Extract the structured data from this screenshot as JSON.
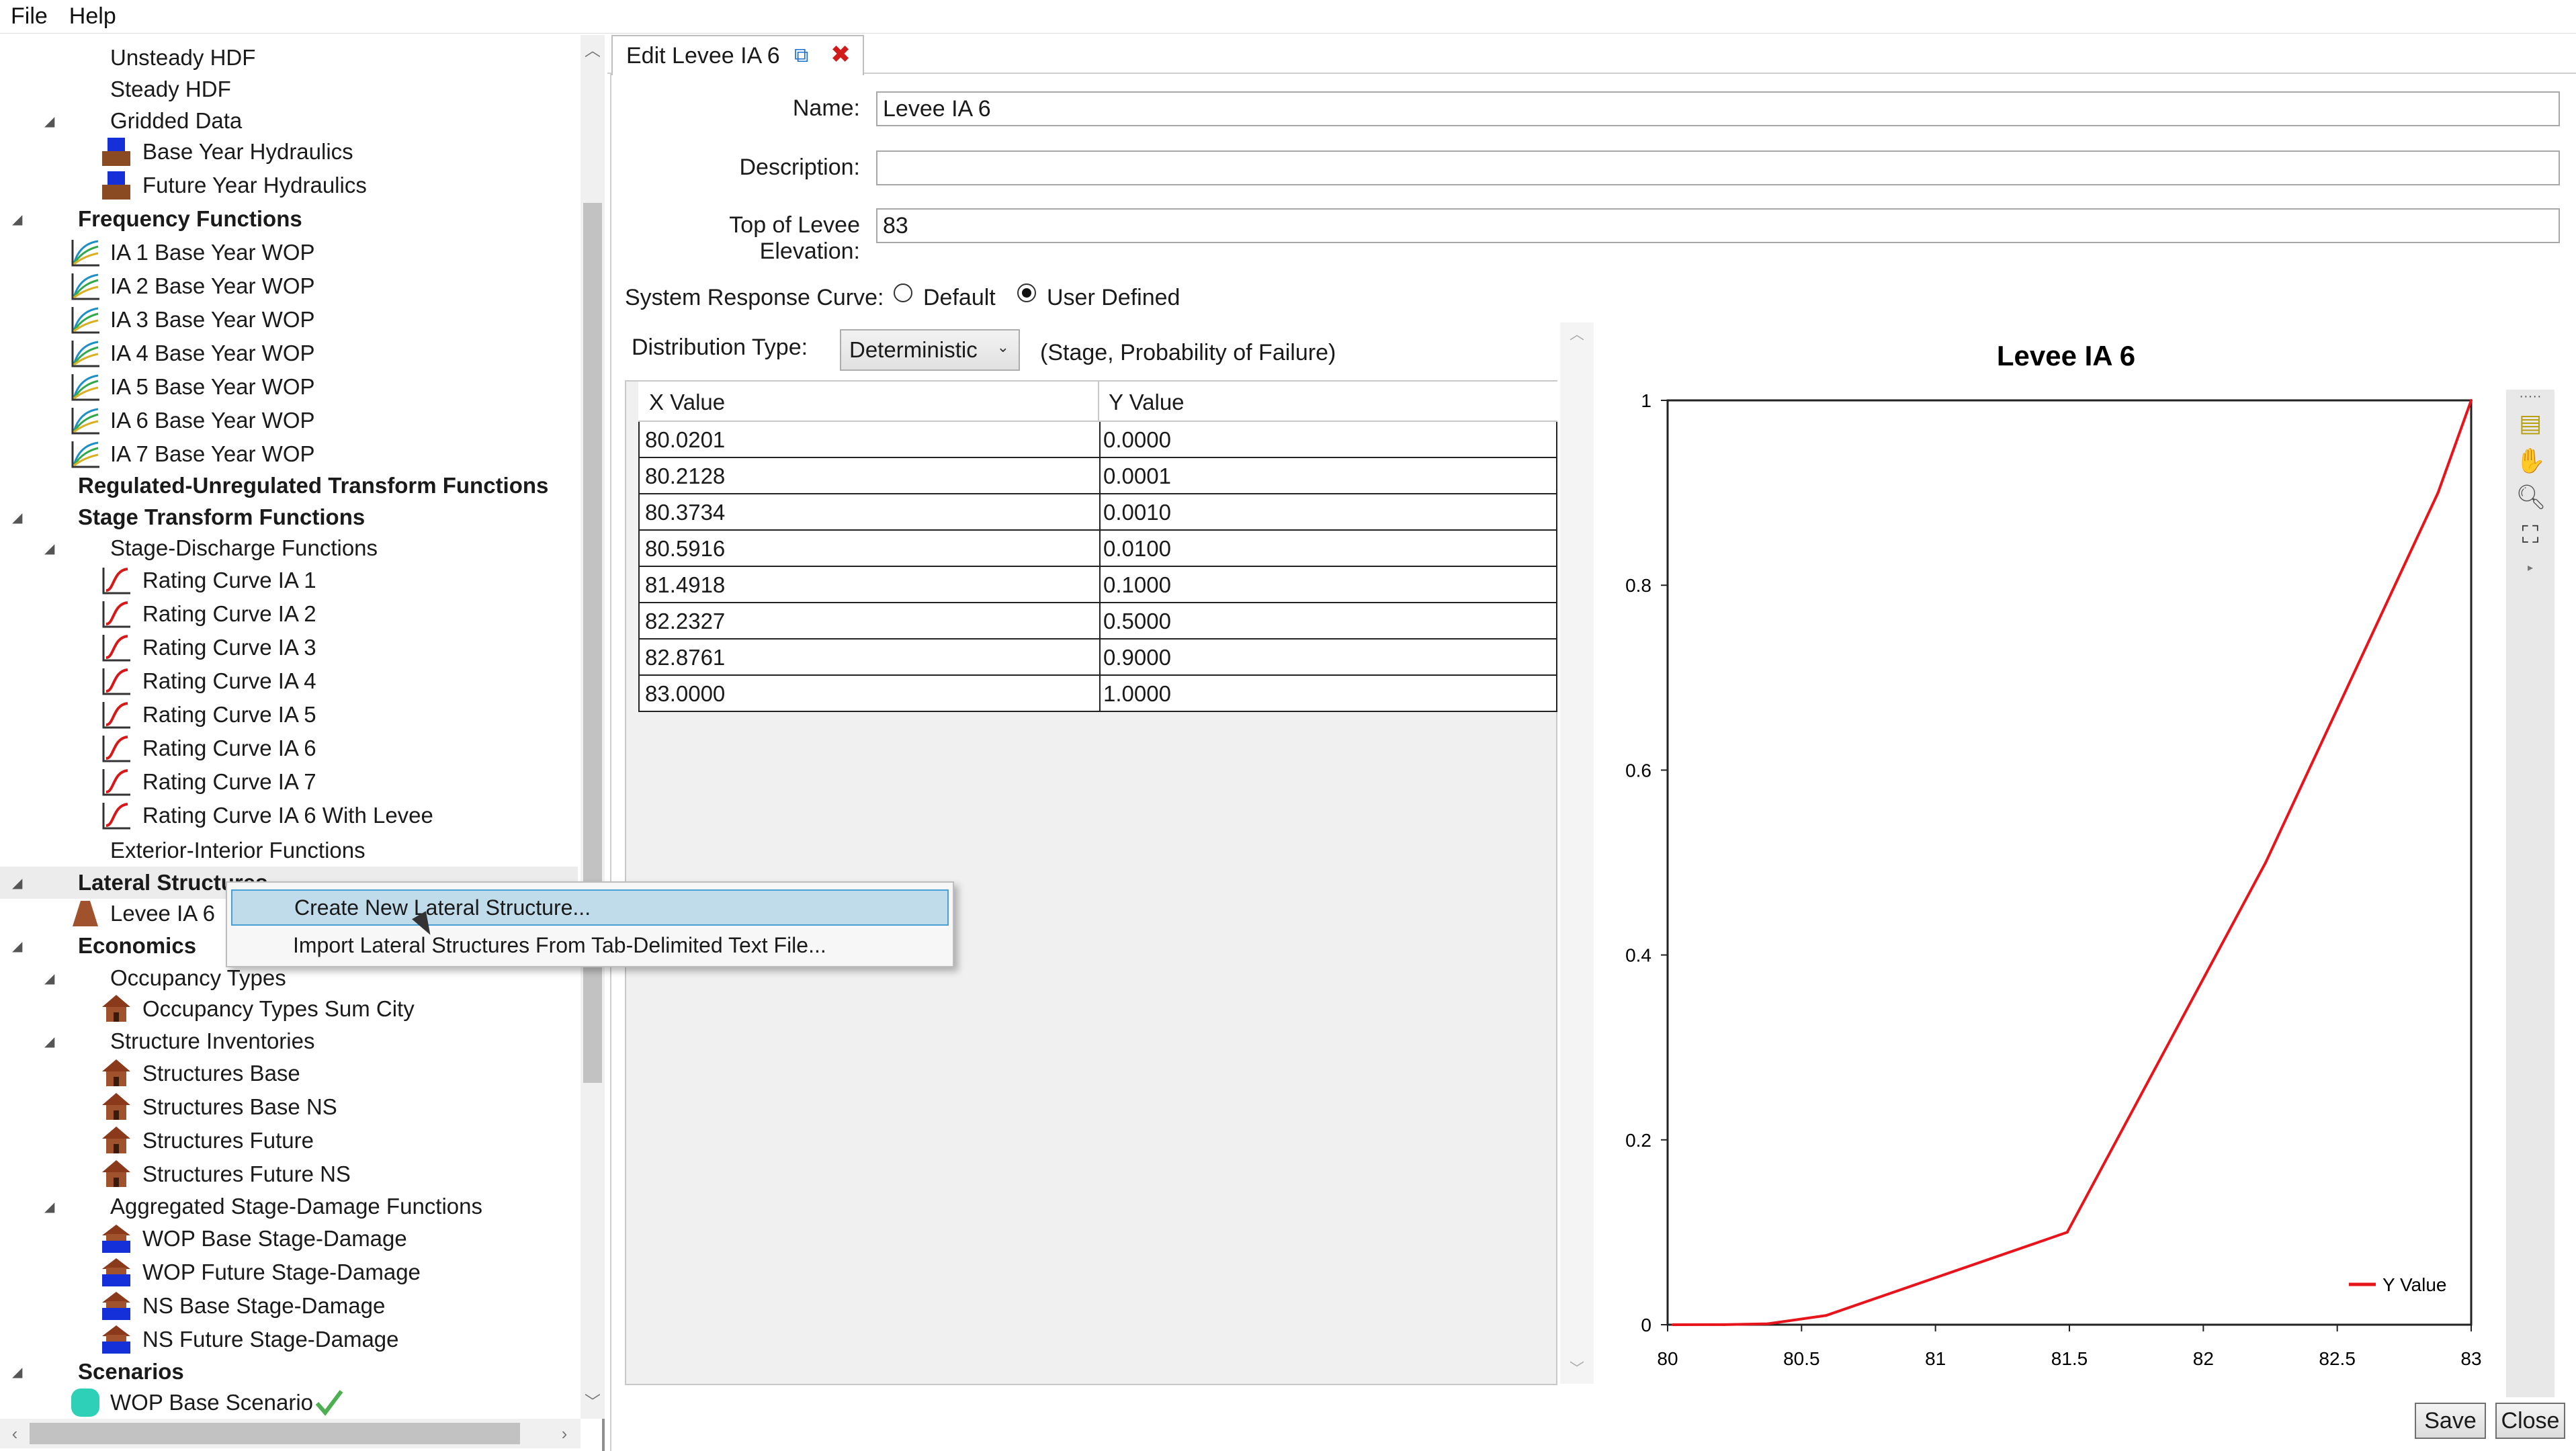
{
  "menu": {
    "file": "File",
    "help": "Help"
  },
  "tree": {
    "unsteady_hdf": "Unsteady HDF",
    "steady_hdf": "Steady HDF",
    "gridded_data": "Gridded Data",
    "base_year_hydraulics": "Base Year Hydraulics",
    "future_year_hydraulics": "Future Year Hydraulics",
    "frequency_functions": "Frequency Functions",
    "freq_items": [
      "IA 1 Base Year WOP",
      "IA 2 Base Year WOP",
      "IA 3 Base Year WOP",
      "IA 4 Base Year WOP",
      "IA 5 Base Year WOP",
      "IA 6 Base Year WOP",
      "IA 7 Base Year WOP"
    ],
    "regulated": "Regulated-Unregulated Transform Functions",
    "stage_transform": "Stage Transform Functions",
    "stage_discharge": "Stage-Discharge Functions",
    "rating_items": [
      "Rating Curve IA 1",
      "Rating Curve IA 2",
      "Rating Curve IA 3",
      "Rating Curve IA 4",
      "Rating Curve IA 5",
      "Rating Curve IA 6",
      "Rating Curve IA 7",
      "Rating Curve IA 6 With Levee"
    ],
    "exterior_interior": "Exterior-Interior Functions",
    "lateral_structures": "Lateral Structures",
    "levee_item": "Levee IA 6",
    "economics": "Economics",
    "occupancy_types": "Occupancy Types",
    "occupancy_sum_city": "Occupancy Types Sum City",
    "structure_inventories": "Structure Inventories",
    "structure_items": [
      "Structures Base",
      "Structures Base NS",
      "Structures Future",
      "Structures Future NS"
    ],
    "aggregated": "Aggregated Stage-Damage Functions",
    "aggregated_items": [
      "WOP Base Stage-Damage",
      "WOP Future Stage-Damage",
      "NS Base Stage-Damage",
      "NS Future Stage-Damage"
    ],
    "scenarios": "Scenarios",
    "scenario_item": "WOP Base Scenario"
  },
  "context_menu": {
    "create": "Create New Lateral Structure...",
    "import": "Import Lateral Structures From Tab-Delimited Text File..."
  },
  "tab": {
    "title": "Edit Levee IA 6"
  },
  "form": {
    "name_label": "Name:",
    "name_value": "Levee IA 6",
    "description_label": "Description:",
    "description_value": "",
    "top_label": "Top of Levee Elevation:",
    "top_value": "83",
    "src_label": "System Response Curve:",
    "default_label": "Default",
    "user_defined_label": "User Defined",
    "dist_label": "Distribution Type:",
    "dist_value": "Deterministic",
    "dist_note": "(Stage, Probability of Failure)"
  },
  "table": {
    "x_header": "X Value",
    "y_header": "Y Value",
    "rows": [
      [
        "80.0201",
        "0.0000"
      ],
      [
        "80.2128",
        "0.0001"
      ],
      [
        "80.3734",
        "0.0010"
      ],
      [
        "80.5916",
        "0.0100"
      ],
      [
        "81.4918",
        "0.1000"
      ],
      [
        "82.2327",
        "0.5000"
      ],
      [
        "82.8761",
        "0.9000"
      ],
      [
        "83.0000",
        "1.0000"
      ]
    ]
  },
  "chart_data": {
    "type": "line",
    "title": "Levee IA 6",
    "xlabel": "",
    "ylabel": "",
    "xlim": [
      80,
      83
    ],
    "ylim": [
      0,
      1
    ],
    "x_ticks": [
      "80",
      "80.5",
      "81",
      "81.5",
      "82",
      "82.5",
      "83"
    ],
    "y_ticks": [
      "0",
      "0.2",
      "0.4",
      "0.6",
      "0.8",
      "1"
    ],
    "grid": false,
    "legend": "bottom-right",
    "series": [
      {
        "name": "Y Value",
        "color": "#e8141b",
        "x": [
          80.0201,
          80.2128,
          80.3734,
          80.5916,
          81.4918,
          82.2327,
          82.8761,
          83.0
        ],
        "y": [
          0.0,
          0.0001,
          0.001,
          0.01,
          0.1,
          0.5,
          0.9,
          1.0
        ]
      }
    ]
  },
  "buttons": {
    "save": "Save",
    "close": "Close"
  }
}
